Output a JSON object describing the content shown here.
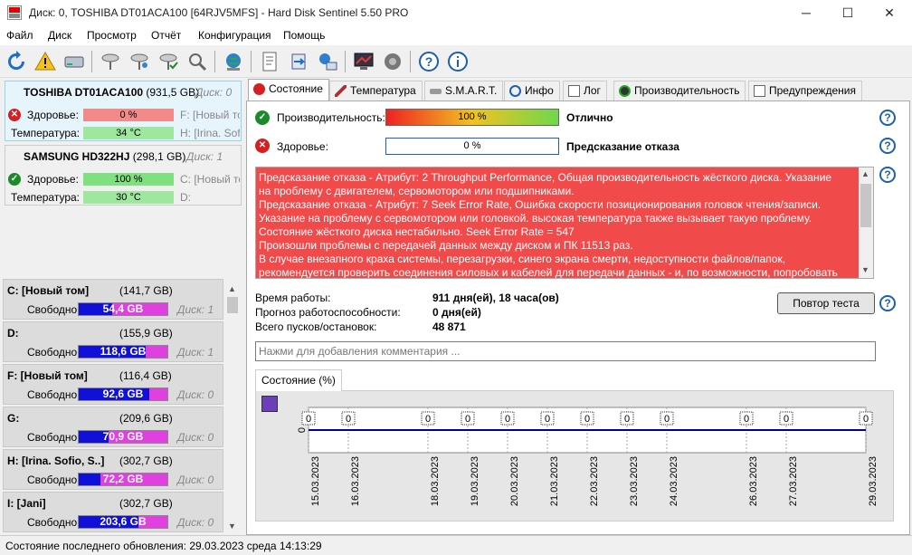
{
  "window": {
    "title": "Диск: 0, TOSHIBA DT01ACA100 [64RJV5MFS]  -  Hard Disk Sentinel 5.50 PRO",
    "minimize": "─",
    "maximize": "☐",
    "close": "✕"
  },
  "menu": [
    "Файл",
    "Диск",
    "Просмотр",
    "Отчёт",
    "Конфигурация",
    "Помощь"
  ],
  "disks": [
    {
      "name": "TOSHIBA DT01ACA100",
      "size": "(931,5 GB)",
      "index": "Диск: 0",
      "health_label": "Здоровье:",
      "health": "0 %",
      "health_ratio": 0.0,
      "temp_label": "Температура:",
      "temp": "34 °C",
      "parts": [
        "F: [Новый то",
        "H: [Irina. Sofi"
      ]
    },
    {
      "name": "SAMSUNG HD322HJ",
      "size": "(298,1 GB)",
      "index": "Диск: 1",
      "health_label": "Здоровье:",
      "health": "100 %",
      "health_ratio": 1.0,
      "temp_label": "Температура:",
      "temp": "30 °C",
      "parts": [
        "C: [Новый то",
        "D:"
      ]
    }
  ],
  "volumes": [
    {
      "name": "C: [Новый том]",
      "size": "(141,7 GB)",
      "free_label": "Свободно",
      "free": "54,4 GB",
      "used_ratio": 0.62,
      "disk": "Диск: 1"
    },
    {
      "name": "D:",
      "size": "(155,9 GB)",
      "free_label": "Свободно",
      "free": "118,6 GB",
      "used_ratio": 0.24,
      "disk": "Диск: 1"
    },
    {
      "name": "F: [Новый том]",
      "size": "(116,4 GB)",
      "free_label": "Свободно",
      "free": "92,6 GB",
      "used_ratio": 0.2,
      "disk": "Диск: 0"
    },
    {
      "name": "G:",
      "size": "(209,6 GB)",
      "free_label": "Свободно",
      "free": "70,9 GB",
      "used_ratio": 0.66,
      "disk": "Диск: 0"
    },
    {
      "name": "H: [Irina. Sofio, S..]",
      "size": "(302,7 GB)",
      "free_label": "Свободно",
      "free": "72,2 GB",
      "used_ratio": 0.76,
      "disk": "Диск: 0"
    },
    {
      "name": "I: [Jani]",
      "size": "(302,7 GB)",
      "free_label": "Свободно",
      "free": "203,6 GB",
      "used_ratio": 0.33,
      "disk": "Диск: 0"
    }
  ],
  "tabs": [
    "Состояние",
    "Температура",
    "S.M.A.R.T.",
    "Инфо",
    "Лог",
    "Производительность",
    "Предупреждения"
  ],
  "status": {
    "perf_label": "Производительность:",
    "perf_value": "100 %",
    "perf_ratio": 1.0,
    "perf_text": "Отлично",
    "health_label": "Здоровье:",
    "health_value": "0 %",
    "health_ratio": 0.0,
    "health_text": "Предсказание отказа",
    "warnings": [
      "Предсказание отказа - Атрибут: 2 Throughput Performance, Общая производительность жёсткого диска. Указание",
      "на проблему с двигателем, сервомотором или подшипниками.",
      "Предсказание отказа - Атрибут: 7 Seek Error Rate, Ошибка скорости позиционирования головок чтения/записи.",
      "Указание на проблему с сервомотором или головкой. высокая температура также вызывает такую проблему.",
      "Состояние жёсткого диска нестабильно. Seek Error Rate = 547",
      "Произошли проблемы с передачей данных между диском и ПК 11513 раз.",
      "В случае внезапного краха системы, перезагрузки, синего экрана смерти, недоступности файлов/папок,",
      "рекомендуется проверить соединения силовых и кабелей для передачи данных - и, по возможности, попробовать"
    ],
    "uptime_label": "Время работы:",
    "uptime": "911 дня(ей), 18 часа(ов)",
    "forecast_label": "Прогноз работоспособности:",
    "forecast": "0 дня(ей)",
    "starts_label": "Всего пусков/остановок:",
    "starts": "48 871",
    "retest_button": "Повтор теста",
    "comment_placeholder": "Нажми для добавления комментария ..."
  },
  "chart_data": {
    "type": "line",
    "tab_label": "Состояние (%)",
    "y_tick": "0",
    "x": [
      "15.03.2023",
      "16.03.2023",
      "18.03.2023",
      "19.03.2023",
      "20.03.2023",
      "21.03.2023",
      "22.03.2023",
      "23.03.2023",
      "24.03.2023",
      "26.03.2023",
      "27.03.2023",
      "29.03.2023"
    ],
    "series": [
      {
        "values": [
          0,
          0,
          0,
          0,
          0,
          0,
          0,
          0,
          0,
          0,
          0,
          0
        ]
      }
    ],
    "x_day_offsets": [
      0,
      1,
      3,
      4,
      5,
      6,
      7,
      8,
      9,
      11,
      12,
      14
    ]
  },
  "statusbar": "Состояние последнего обновления: 29.03.2023 среда 14:13:29",
  "colors": {
    "health_bad": "#f06a6a",
    "health_good": "#7ee07e",
    "warn_bg": "#f04a4a",
    "vol_used": "#1010d8",
    "vol_free": "#e040e0",
    "series": "#0000a0"
  }
}
